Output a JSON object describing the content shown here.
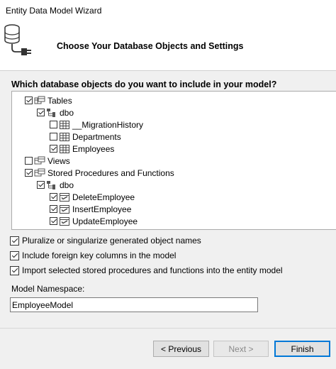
{
  "window": {
    "title": "Entity Data Model Wizard"
  },
  "header": {
    "title": "Choose Your Database Objects and Settings",
    "icon": "database-plug-icon"
  },
  "objects": {
    "label": "Which database objects do you want to include in your model?",
    "tree": {
      "tables": {
        "label": "Tables",
        "checked": true
      },
      "tables_dbo": {
        "label": "dbo",
        "checked": true
      },
      "migration_history": {
        "label": "__MigrationHistory",
        "checked": false
      },
      "departments": {
        "label": "Departments",
        "checked": false
      },
      "employees": {
        "label": "Employees",
        "checked": true
      },
      "views": {
        "label": "Views",
        "checked": false
      },
      "stored_procs": {
        "label": "Stored Procedures and Functions",
        "checked": true
      },
      "procs_dbo": {
        "label": "dbo",
        "checked": true
      },
      "delete_employee": {
        "label": "DeleteEmployee",
        "checked": true
      },
      "insert_employee": {
        "label": "InsertEmployee",
        "checked": true
      },
      "update_employee": {
        "label": "UpdateEmployee",
        "checked": true
      }
    }
  },
  "options": {
    "pluralize": {
      "label": "Pluralize or singularize generated object names",
      "checked": true
    },
    "foreign_keys": {
      "label": "Include foreign key columns in the model",
      "checked": true
    },
    "import_procs": {
      "label": "Import selected stored procedures and functions into the entity model",
      "checked": true
    }
  },
  "namespace": {
    "label": "Model Namespace:",
    "value": "EmployeeModel"
  },
  "buttons": {
    "previous": "< Previous",
    "next": "Next >",
    "finish": "Finish"
  },
  "colors": {
    "accent": "#0078d7",
    "table_grid": "#3a6fb0",
    "folder": "#555555"
  }
}
